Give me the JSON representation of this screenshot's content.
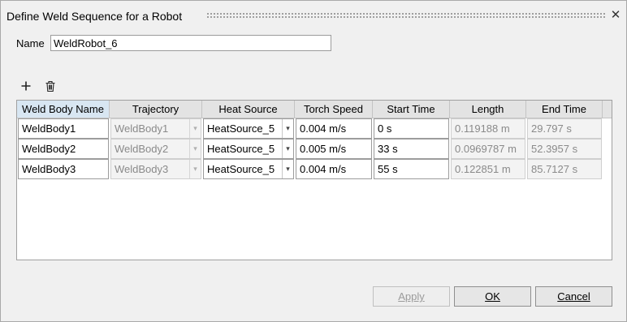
{
  "window": {
    "title": "Define Weld Sequence for a Robot",
    "close_glyph": "✕"
  },
  "name_field": {
    "label": "Name",
    "value": "WeldRobot_6"
  },
  "toolbar": {
    "add_icon": "plus-icon",
    "delete_icon": "trash-icon"
  },
  "table": {
    "columns": [
      "Weld Body Name",
      "Trajectory",
      "Heat Source",
      "Torch Speed",
      "Start Time",
      "Length",
      "End Time"
    ],
    "rows": [
      {
        "weld_body": "WeldBody1",
        "trajectory": "WeldBody1",
        "heat_source": "HeatSource_5",
        "torch_speed": "0.004 m/s",
        "start_time": "0 s",
        "length": "0.119188 m",
        "end_time": "29.797 s"
      },
      {
        "weld_body": "WeldBody2",
        "trajectory": "WeldBody2",
        "heat_source": "HeatSource_5",
        "torch_speed": "0.005 m/s",
        "start_time": "33 s",
        "length": "0.0969787 m",
        "end_time": "52.3957 s"
      },
      {
        "weld_body": "WeldBody3",
        "trajectory": "WeldBody3",
        "heat_source": "HeatSource_5",
        "torch_speed": "0.004 m/s",
        "start_time": "55 s",
        "length": "0.122851 m",
        "end_time": "85.7127 s"
      }
    ]
  },
  "buttons": {
    "apply": "Apply",
    "ok": "OK",
    "cancel": "Cancel"
  },
  "colors": {
    "header_bg": "#e3e3e3",
    "selected_header_bg": "#d8e6f2",
    "readonly_text": "#8a8a8a"
  }
}
